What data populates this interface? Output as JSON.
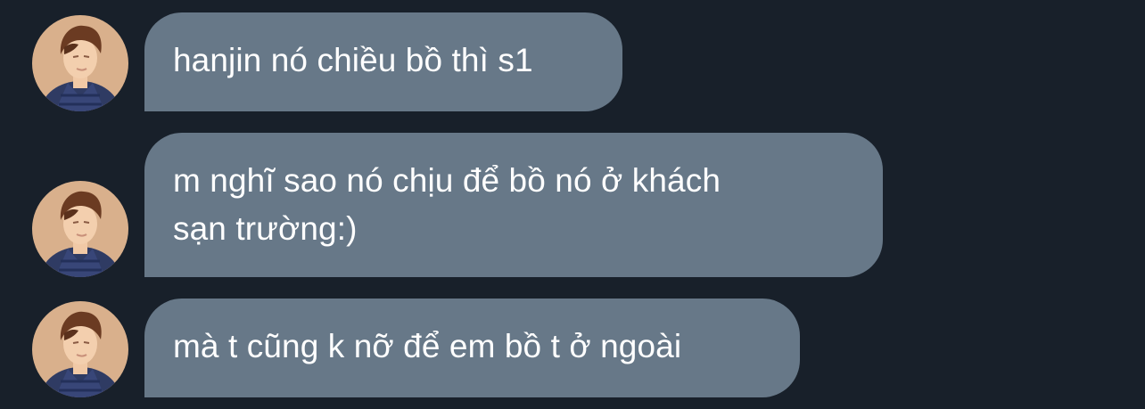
{
  "conversation": {
    "messages": [
      {
        "text": "hanjin nó chiều bồ thì s1",
        "avatar_icon": "user-avatar-icon"
      },
      {
        "text": "m nghĩ sao nó chịu để bồ nó ở khách\nsạn trường:)",
        "avatar_icon": "user-avatar-icon"
      },
      {
        "text": "mà t cũng k nỡ để em bồ t ở ngoài",
        "avatar_icon": "user-avatar-icon"
      }
    ]
  },
  "colors": {
    "background": "#18202a",
    "bubble": "#677888",
    "text": "#ffffff"
  }
}
